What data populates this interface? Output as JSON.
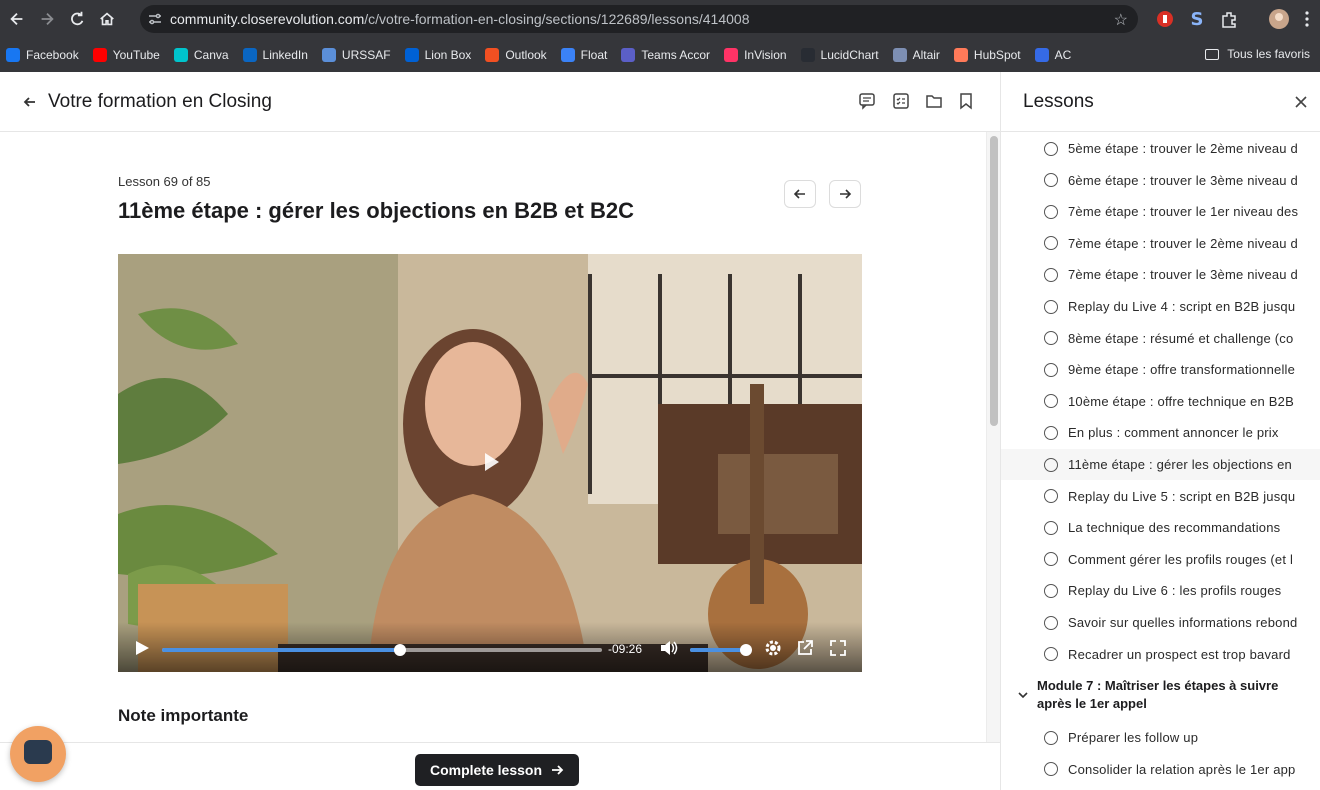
{
  "browser": {
    "url_host": "community.closerevolution.com",
    "url_path": "/c/votre-formation-en-closing/sections/122689/lessons/414008",
    "bookmarks": [
      {
        "label": "Facebook",
        "icon": "facebook-icon",
        "color": "#1877f2"
      },
      {
        "label": "YouTube",
        "icon": "youtube-icon",
        "color": "#ff0000"
      },
      {
        "label": "Canva",
        "icon": "canva-icon",
        "color": "#00c4cc"
      },
      {
        "label": "LinkedIn",
        "icon": "linkedin-icon",
        "color": "#0a66c2"
      },
      {
        "label": "URSSAF",
        "icon": "urssaf-icon",
        "color": "#5b8fd9"
      },
      {
        "label": "Lion Box",
        "icon": "box-icon",
        "color": "#0061d5"
      },
      {
        "label": "Outlook",
        "icon": "outlook-icon",
        "color": "#f25022"
      },
      {
        "label": "Float",
        "icon": "float-icon",
        "color": "#3b82f6"
      },
      {
        "label": "Teams Accor",
        "icon": "teams-icon",
        "color": "#5b5fc7"
      },
      {
        "label": "InVision",
        "icon": "invision-icon",
        "color": "#ff3366"
      },
      {
        "label": "LucidChart",
        "icon": "lucidchart-icon",
        "color": "#282c33"
      },
      {
        "label": "Altair",
        "icon": "altair-icon",
        "color": "#7d8fb3"
      },
      {
        "label": "HubSpot",
        "icon": "hubspot-icon",
        "color": "#ff7a59"
      },
      {
        "label": "AC",
        "icon": "activecampaign-icon",
        "color": "#356ae6"
      }
    ],
    "all_bookmarks_label": "Tous les favoris"
  },
  "header": {
    "course_title": "Votre formation en Closing"
  },
  "lesson": {
    "count_label": "Lesson 69 of 85",
    "title": "11ème étape : gérer les objections en B2B et B2C",
    "video": {
      "time_remaining": "-09:26",
      "progress": 0.54,
      "volume": 1.0
    },
    "note_title": "Note importante",
    "complete_label": "Complete lesson"
  },
  "sidebar": {
    "title": "Lessons",
    "items": [
      {
        "label": "5ème étape : trouver le 2ème niveau d",
        "active": false
      },
      {
        "label": "6ème étape : trouver le 3ème niveau d",
        "active": false
      },
      {
        "label": "7ème étape : trouver le 1er niveau des",
        "active": false
      },
      {
        "label": "7ème étape : trouver le 2ème niveau d",
        "active": false
      },
      {
        "label": "7ème étape : trouver le 3ème niveau d",
        "active": false
      },
      {
        "label": "Replay du Live 4 : script en B2B jusqu",
        "active": false
      },
      {
        "label": "8ème étape : résumé et challenge (co",
        "active": false
      },
      {
        "label": "9ème étape : offre transformationnelle",
        "active": false
      },
      {
        "label": "10ème étape : offre technique en B2B",
        "active": false
      },
      {
        "label": "En plus : comment annoncer le prix",
        "active": false
      },
      {
        "label": "11ème étape : gérer les objections en",
        "active": true
      },
      {
        "label": "Replay du Live 5 : script en B2B jusqu",
        "active": false
      },
      {
        "label": "La technique des recommandations",
        "active": false
      },
      {
        "label": "Comment gérer les profils rouges (et l",
        "active": false
      },
      {
        "label": "Replay du Live 6 : les profils rouges",
        "active": false
      },
      {
        "label": "Savoir sur quelles informations rebond",
        "active": false
      },
      {
        "label": "Recadrer un prospect est trop bavard",
        "active": false
      }
    ],
    "module": {
      "title": "Module 7 : Maîtriser les étapes à suivre après le 1er appel",
      "items": [
        {
          "label": "Préparer les follow up"
        },
        {
          "label": "Consolider la relation après le 1er app"
        }
      ]
    }
  },
  "colors": {
    "accent": "#4a90e2",
    "button_dark": "#1f2023",
    "chat_bubble": "#f1a163"
  }
}
